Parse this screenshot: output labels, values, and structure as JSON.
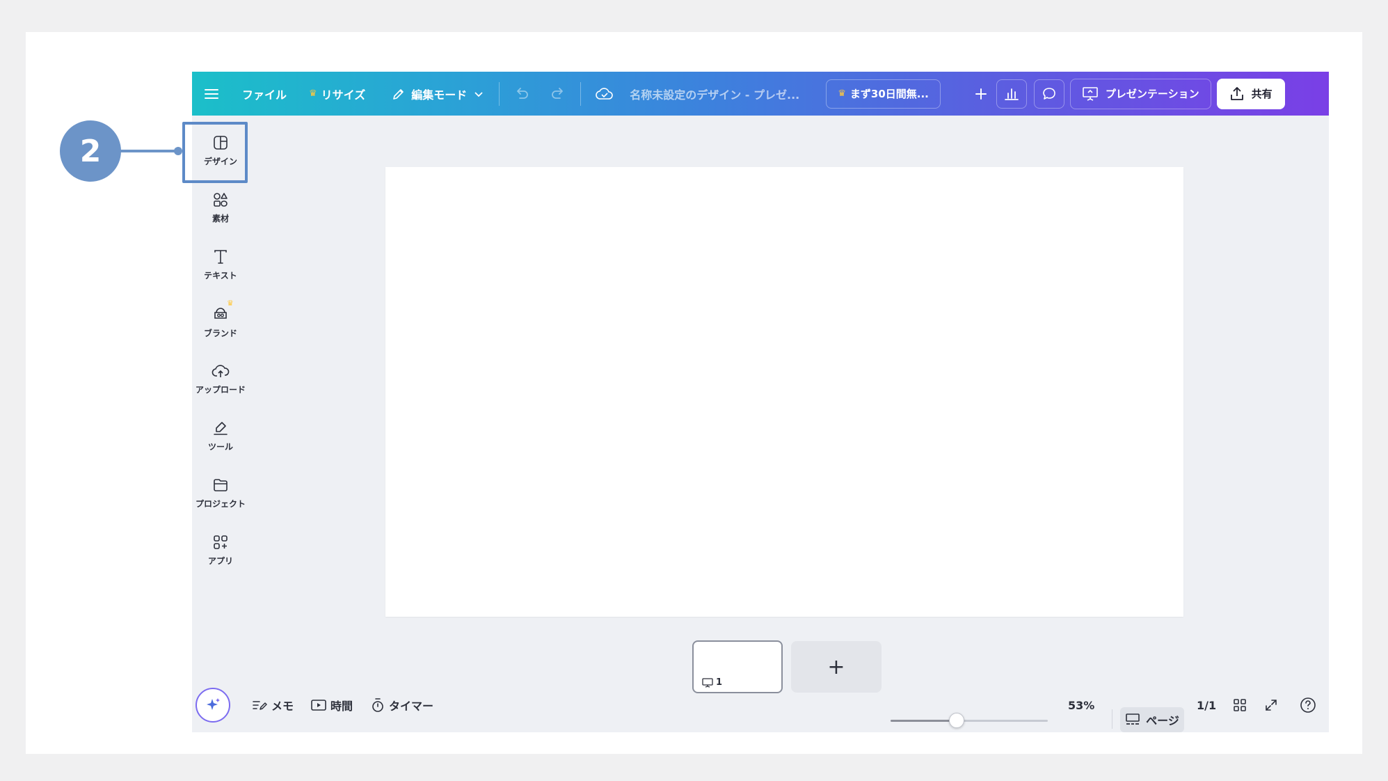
{
  "topbar": {
    "file_label": "ファイル",
    "resize_label": "リサイズ",
    "edit_mode_label": "編集モード",
    "design_title": "名称未設定のデザイン - プレゼ...",
    "trial_label": "まず30日間無...",
    "present_label": "プレゼンテーション",
    "share_label": "共有"
  },
  "sidebar": {
    "items": [
      {
        "label": "デザイン",
        "icon": "layout-icon"
      },
      {
        "label": "素材",
        "icon": "shapes-icon"
      },
      {
        "label": "テキスト",
        "icon": "text-icon"
      },
      {
        "label": "ブランド",
        "icon": "brand-icon"
      },
      {
        "label": "アップロード",
        "icon": "cloud-upload-icon"
      },
      {
        "label": "ツール",
        "icon": "pen-tool-icon"
      },
      {
        "label": "プロジェクト",
        "icon": "folder-icon"
      },
      {
        "label": "アプリ",
        "icon": "apps-icon"
      }
    ]
  },
  "callout": {
    "number": "2"
  },
  "pages": {
    "thumb_number": "1",
    "add_label": "+"
  },
  "bottombar": {
    "memo_label": "メモ",
    "time_label": "時間",
    "timer_label": "タイマー",
    "zoom_value": "53%",
    "page_view_label": "ページ",
    "page_count": "1/1"
  },
  "colors": {
    "gradient_start": "#1bbfc9",
    "gradient_end": "#7a3fe6",
    "callout": "#6c94c8",
    "crown": "#ffc83d"
  },
  "zoom_fraction": 0.42
}
